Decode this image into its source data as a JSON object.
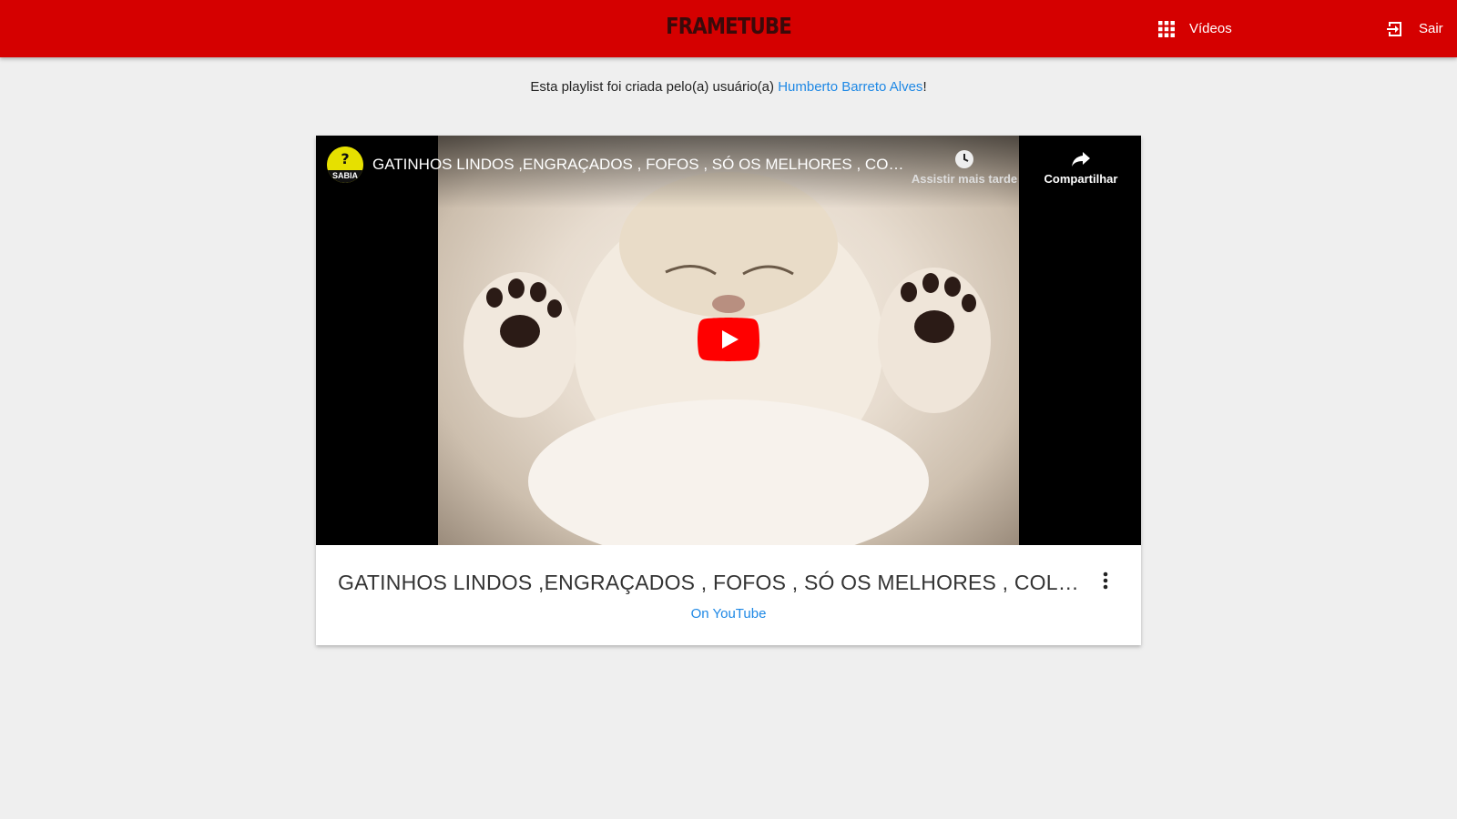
{
  "header": {
    "brand": "FRAMETUBE",
    "nav": {
      "videos_label": "Vídeos",
      "exit_label": "Sair"
    },
    "color": "#d50000"
  },
  "playlist": {
    "creator_prefix": "Esta playlist foi criada pelo(a) usuário(a) ",
    "creator_name": "Humberto Barreto Alves",
    "creator_suffix": "!"
  },
  "video": {
    "overlay_title": "GATINHOS LINDOS ,ENGRAÇADOS , FOFOS , SÓ OS MELHORES , COLETÂNEA ...",
    "channel_avatar_text": "SABIA",
    "watch_later_label": "Assistir mais tarde",
    "share_label": "Compartilhar",
    "card_title": "GATINHOS LINDOS ,ENGRAÇADOS , FOFOS , SÓ OS MELHORES , COLETÂNEA ...",
    "link_label": "On YouTube"
  },
  "icons": {
    "nav_videos": "apps-grid-icon",
    "nav_exit": "exit-icon",
    "watch_later": "clock-icon",
    "share": "share-arrow-icon",
    "play": "youtube-play-icon",
    "more": "more-vert-icon"
  },
  "colors": {
    "link": "#1e88e5",
    "play": "#ff0000",
    "background": "#efefef"
  }
}
